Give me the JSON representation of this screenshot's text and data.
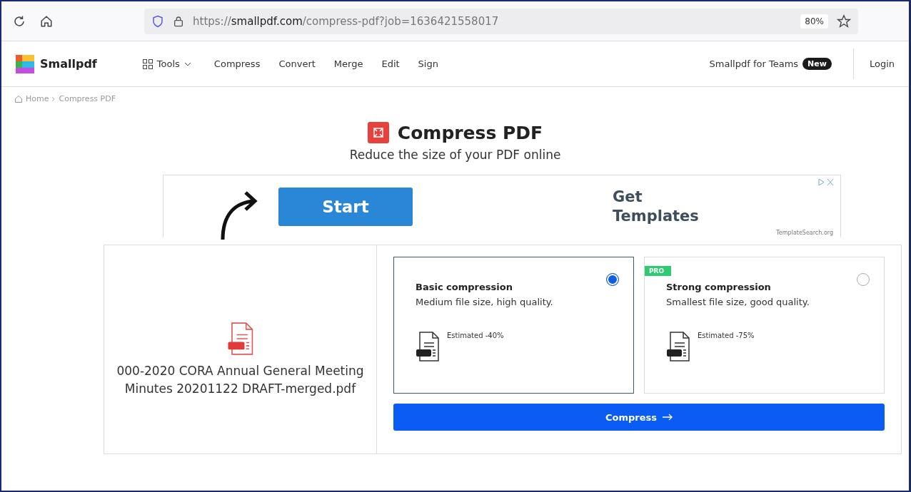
{
  "browser": {
    "url": {
      "scheme": "https://",
      "host": "smallpdf.com",
      "path": "/compress-pdf?job=1636421558017"
    },
    "zoom": "80%"
  },
  "nav": {
    "logo": "Smallpdf",
    "tools": "Tools",
    "links": [
      "Compress",
      "Convert",
      "Merge",
      "Edit",
      "Sign"
    ],
    "teams": "Smallpdf for Teams",
    "teams_badge": "New",
    "login": "Login"
  },
  "breadcrumb": [
    "Home",
    "Compress PDF"
  ],
  "header": {
    "title": "Compress PDF",
    "subtitle": "Reduce the size of your PDF online"
  },
  "ad": {
    "button": "Start",
    "headline": [
      "Get",
      "Templates"
    ],
    "source": "TemplateSearch.org"
  },
  "file": {
    "name": "000-2020 CORA Annual General Meeting Minutes 20201122 DRAFT-merged.pdf"
  },
  "options": [
    {
      "title": "Basic compression",
      "description": "Medium file size, high quality.",
      "estimate": "Estimated -40%",
      "selected": true
    },
    {
      "title": "Strong compression",
      "description": "Smallest file size, good quality.",
      "estimate": "Estimated -75%",
      "selected": false,
      "badge": "PRO"
    }
  ],
  "compress_button": "Compress"
}
